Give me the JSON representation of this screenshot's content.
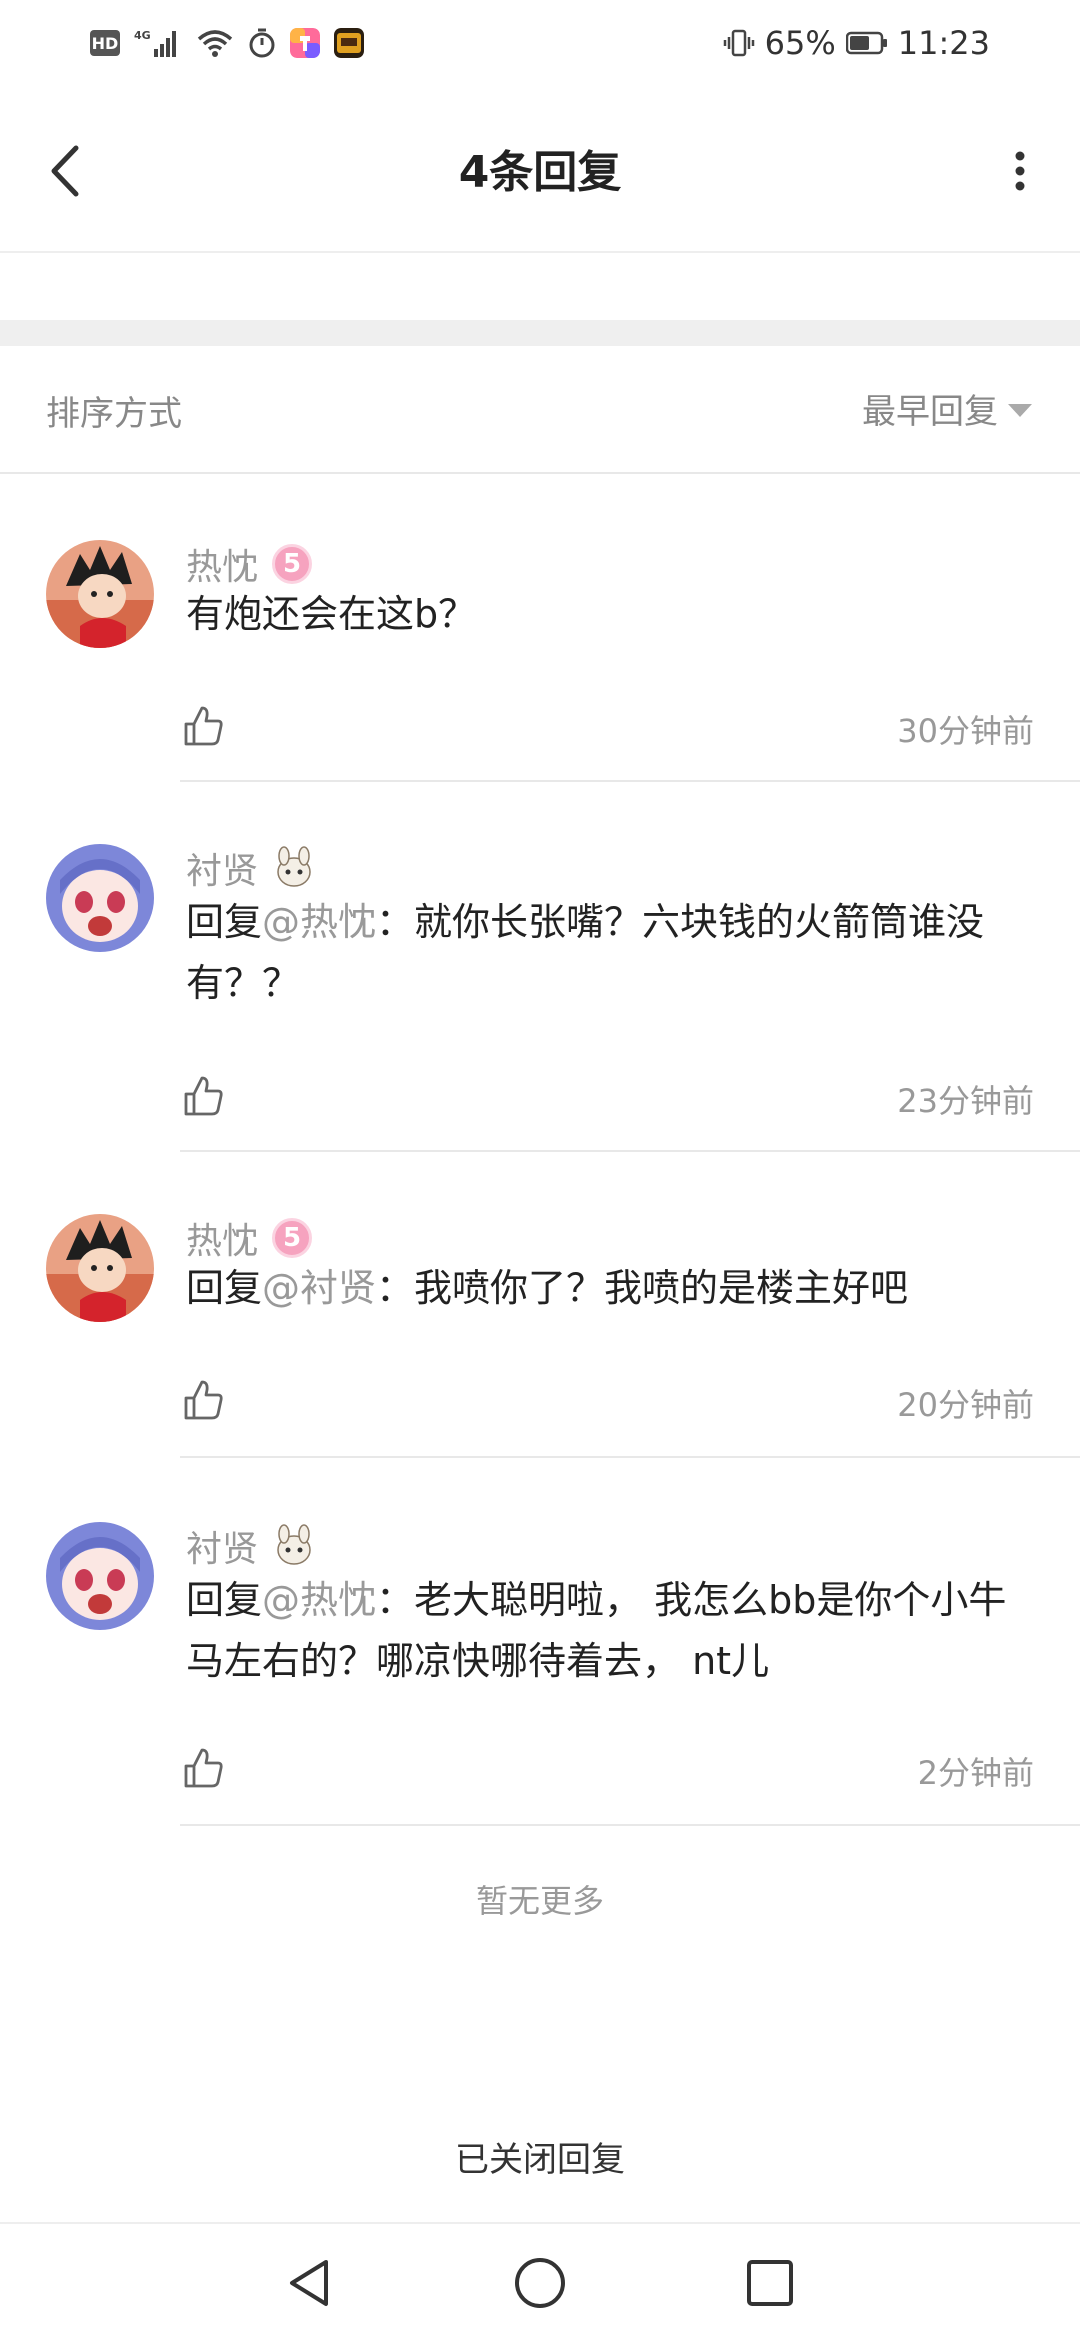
{
  "status_bar": {
    "hd": "HD",
    "net": "4G",
    "battery_percent": "65%",
    "time": "11:23",
    "icons": [
      "signal-icon",
      "wifi-icon",
      "alarm-icon",
      "app-icon",
      "game-icon",
      "vibrate-icon",
      "battery-icon"
    ]
  },
  "header": {
    "title": "4条回复"
  },
  "sort": {
    "label": "排序方式",
    "selected": "最早回复"
  },
  "comments": [
    {
      "user": "热忱",
      "badge": "5",
      "reply_prefix": "",
      "mention": "",
      "text": "有炮还会在这b？",
      "time": "30分钟前"
    },
    {
      "user": "衬贤",
      "badge": "bunny",
      "reply_prefix": "回复",
      "mention": "@热忱",
      "text": "：就你长张嘴？六块钱的火箭筒谁没有？？",
      "time": "23分钟前"
    },
    {
      "user": "热忱",
      "badge": "5",
      "reply_prefix": "回复",
      "mention": "@衬贤",
      "text": "：我喷你了？我喷的是楼主好吧",
      "time": "20分钟前"
    },
    {
      "user": "衬贤",
      "badge": "bunny",
      "reply_prefix": "回复",
      "mention": "@热忱",
      "text": "：老大聪明啦， 我怎么bb是你个小牛马左右的？哪凉快哪待着去， nt儿",
      "time": "2分钟前"
    }
  ],
  "footer": {
    "no_more": "暂无更多",
    "closed": "已关闭回复"
  },
  "colors": {
    "text": "#222222",
    "muted": "#999999",
    "divider": "#e8e8e8",
    "badge_pink": "#f6a3bf"
  }
}
